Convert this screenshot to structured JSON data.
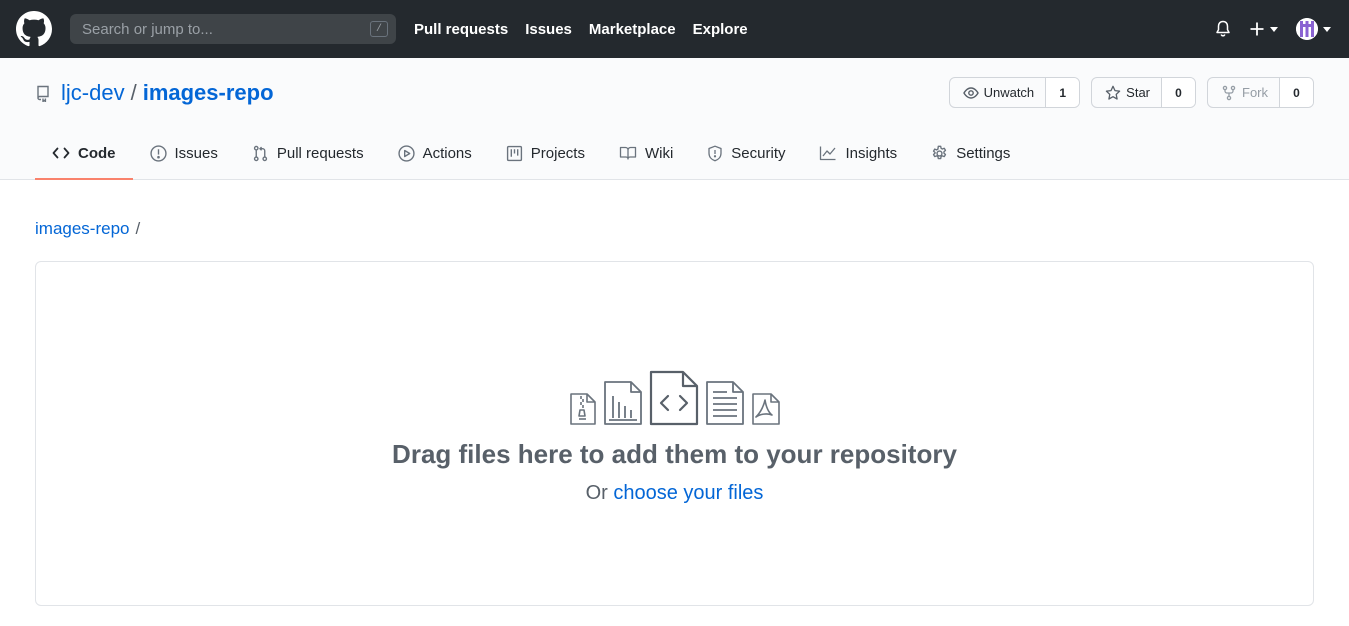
{
  "header": {
    "search_placeholder": "Search or jump to...",
    "search_shortcut": "/",
    "nav": [
      "Pull requests",
      "Issues",
      "Marketplace",
      "Explore"
    ]
  },
  "repo": {
    "owner": "ljc-dev",
    "separator": "/",
    "name": "images-repo",
    "watch": {
      "label": "Unwatch",
      "count": "1"
    },
    "star": {
      "label": "Star",
      "count": "0"
    },
    "fork": {
      "label": "Fork",
      "count": "0"
    }
  },
  "tabs": [
    {
      "label": "Code",
      "icon": "code-icon",
      "selected": true
    },
    {
      "label": "Issues",
      "icon": "issue-icon"
    },
    {
      "label": "Pull requests",
      "icon": "pull-request-icon"
    },
    {
      "label": "Actions",
      "icon": "play-icon"
    },
    {
      "label": "Projects",
      "icon": "project-icon"
    },
    {
      "label": "Wiki",
      "icon": "book-icon"
    },
    {
      "label": "Security",
      "icon": "shield-icon"
    },
    {
      "label": "Insights",
      "icon": "graph-icon"
    },
    {
      "label": "Settings",
      "icon": "gear-icon"
    }
  ],
  "breadcrumb": {
    "repo": "images-repo",
    "slash": "/"
  },
  "upload": {
    "title": "Drag files here to add them to your repository",
    "or_text": "Or",
    "choose_link": "choose your files"
  },
  "colors": {
    "header_bg": "#24292e",
    "link": "#0366d6",
    "tab_underline": "#f9826c"
  }
}
